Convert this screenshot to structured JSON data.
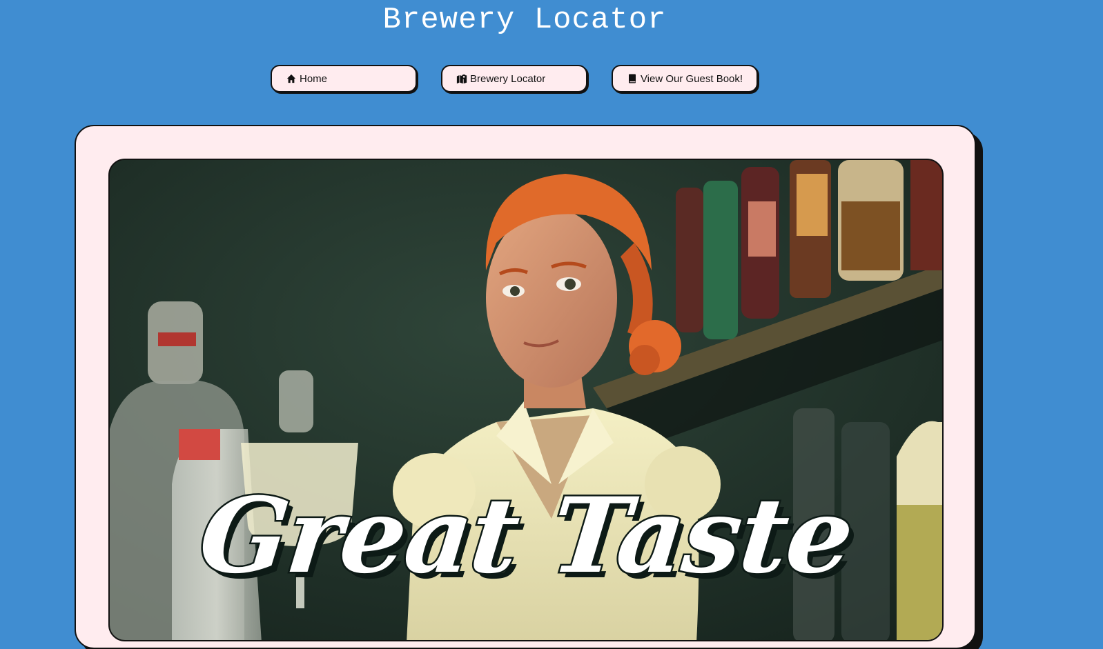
{
  "site": {
    "title": "Brewery Locator"
  },
  "nav": {
    "items": [
      {
        "label": "Home",
        "icon": "home-icon"
      },
      {
        "label": "Brewery Locator",
        "icon": "map-pin-icon"
      },
      {
        "label": "View Our Guest Book!",
        "icon": "book-icon"
      }
    ]
  },
  "hero": {
    "image_alt": "Illustrated bartender with red hair in a cream blouse standing before shelves of bottles",
    "headline": "Great Taste"
  },
  "colors": {
    "page_background": "#408dd1",
    "card_background": "#ffecef",
    "outline": "#111111",
    "headline_fill": "#ffffff"
  }
}
